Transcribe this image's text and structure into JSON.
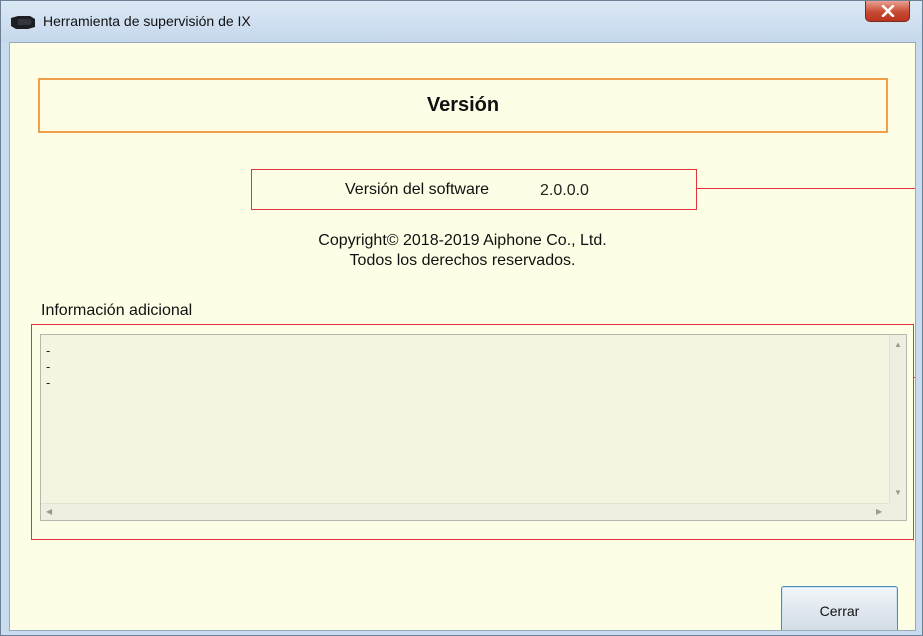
{
  "window": {
    "title": "Herramienta de supervisión de IX",
    "close_icon": "close-x-icon",
    "app_icon": "camera-icon"
  },
  "header": {
    "title": "Versión"
  },
  "version": {
    "label": "Versión del software",
    "value": "2.0.0.0"
  },
  "copyright": {
    "line1": "Copyright© 2018-2019 Aiphone Co., Ltd.",
    "line2": "Todos los derechos reservados."
  },
  "additional_info": {
    "label": "Información adicional",
    "lines": [
      "-",
      "-",
      "-"
    ]
  },
  "buttons": {
    "close_label": "Cerrar"
  },
  "colors": {
    "client_background": "#fefde5",
    "header_border": "#f0a04a",
    "callout_red": "#e0363a",
    "close_button_red": "#c94a33"
  }
}
